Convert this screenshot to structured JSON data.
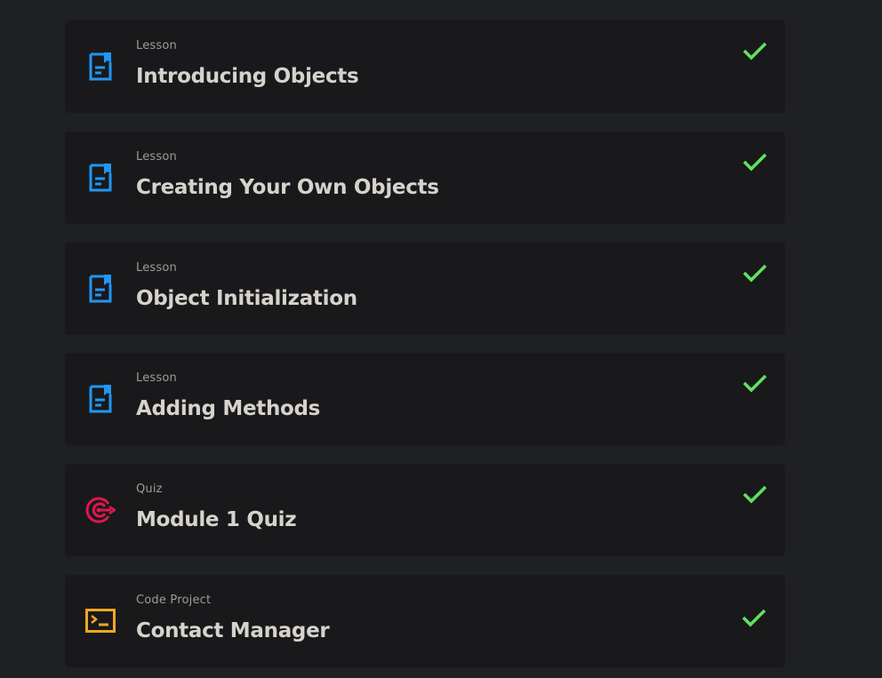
{
  "items": [
    {
      "type": "Lesson",
      "title": "Introducing Objects",
      "icon": "lesson-document-icon",
      "completed": true
    },
    {
      "type": "Lesson",
      "title": "Creating Your Own Objects",
      "icon": "lesson-document-icon",
      "completed": true
    },
    {
      "type": "Lesson",
      "title": "Object Initialization",
      "icon": "lesson-document-icon",
      "completed": true
    },
    {
      "type": "Lesson",
      "title": "Adding Methods",
      "icon": "lesson-document-icon",
      "completed": true
    },
    {
      "type": "Quiz",
      "title": "Module 1 Quiz",
      "icon": "quiz-target-icon",
      "completed": true
    },
    {
      "type": "Code Project",
      "title": "Contact Manager",
      "icon": "code-terminal-icon",
      "completed": true
    }
  ],
  "colors": {
    "lesson_icon": "#2196f3",
    "quiz_icon": "#e0174f",
    "code_icon": "#f5a623",
    "check": "#5fe360"
  }
}
